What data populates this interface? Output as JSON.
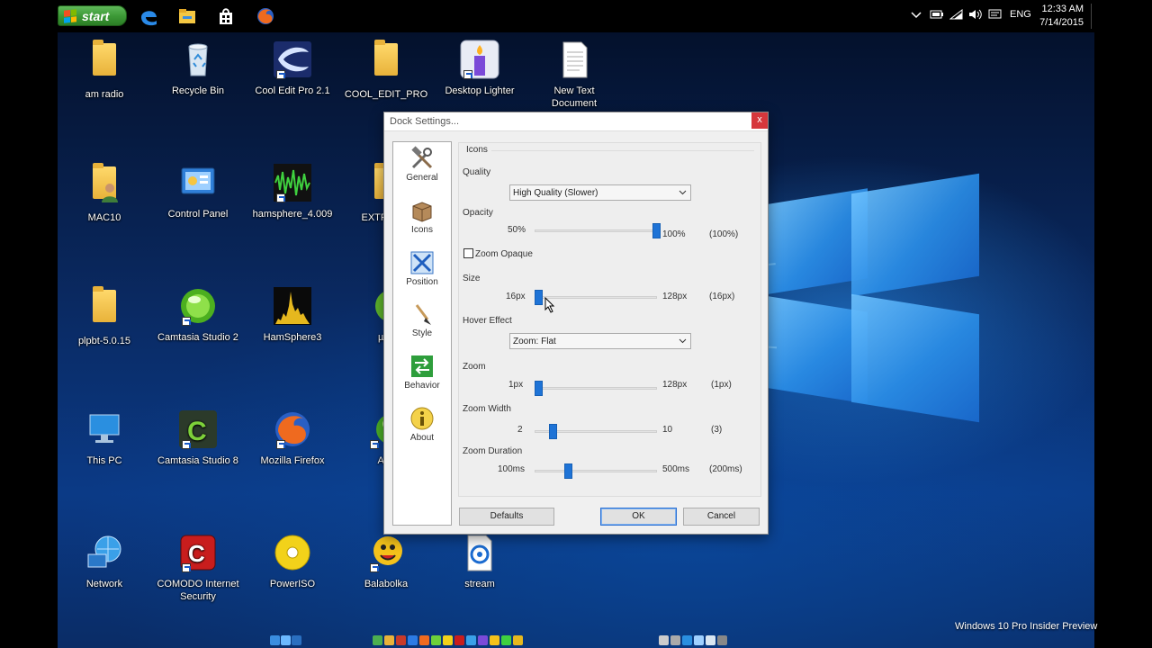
{
  "taskbar": {
    "start_label": "start",
    "tray_language": "ENG",
    "clock_time": "12:33 AM",
    "clock_date": "7/14/2015",
    "pins": [
      "edge-icon",
      "file-explorer-icon",
      "store-icon",
      "firefox-icon"
    ]
  },
  "desktop": {
    "icons": [
      {
        "label": "am radio",
        "icon": "folder-icon"
      },
      {
        "label": "Recycle Bin",
        "icon": "recycle-bin-icon"
      },
      {
        "label": "Cool Edit Pro 2.1",
        "icon": "cool-edit-icon"
      },
      {
        "label": "COOL_EDIT_PRO",
        "icon": "folder-icon"
      },
      {
        "label": "Desktop Lighter",
        "icon": "candle-icon"
      },
      {
        "label": "New Text Document",
        "icon": "text-document-icon"
      },
      {
        "label": "MAC10",
        "icon": "user-folder-icon"
      },
      {
        "label": "Control Panel",
        "icon": "control-panel-icon"
      },
      {
        "label": "hamsphere_4.009",
        "icon": "waveform-icon"
      },
      {
        "label": "EXTRA DR",
        "icon": "folder-icon"
      },
      {
        "label": "plpbt-5.0.15",
        "icon": "folder-icon"
      },
      {
        "label": "Camtasia Studio 2",
        "icon": "camtasia-orb-icon"
      },
      {
        "label": "HamSphere3",
        "icon": "spectrum-icon"
      },
      {
        "label": "µTo",
        "icon": "utorrent-icon"
      },
      {
        "label": "This PC",
        "icon": "this-pc-icon"
      },
      {
        "label": "Camtasia Studio 8",
        "icon": "camtasia-icon"
      },
      {
        "label": "Mozilla Firefox",
        "icon": "firefox-icon"
      },
      {
        "label": "Any",
        "icon": "green-orb-icon"
      },
      {
        "label": "Network",
        "icon": "network-icon"
      },
      {
        "label": "COMODO Internet Security",
        "icon": "comodo-icon"
      },
      {
        "label": "PowerISO",
        "icon": "disc-icon"
      },
      {
        "label": "Balabolka",
        "icon": "balabolka-icon"
      },
      {
        "label": "stream",
        "icon": "stream-icon"
      }
    ],
    "watermark": "Windows 10 Pro Insider Preview"
  },
  "dialog": {
    "title": "Dock Settings...",
    "close_label": "x",
    "nav": [
      {
        "label": "General",
        "icon": "tools-icon"
      },
      {
        "label": "Icons",
        "icon": "box-icon"
      },
      {
        "label": "Position",
        "icon": "position-icon"
      },
      {
        "label": "Style",
        "icon": "brush-icon"
      },
      {
        "label": "Behavior",
        "icon": "behavior-icon"
      },
      {
        "label": "About",
        "icon": "info-icon"
      }
    ],
    "group_title": "Icons",
    "quality": {
      "label": "Quality",
      "value": "High Quality (Slower)"
    },
    "opacity": {
      "label": "Opacity",
      "min": "50%",
      "max": "100%",
      "current": "(100%)",
      "fraction": 1.0
    },
    "zoom_opaque": {
      "label": "Zoom Opaque",
      "checked": false
    },
    "size": {
      "label": "Size",
      "min": "16px",
      "max": "128px",
      "current": "(16px)",
      "fraction": 0.0
    },
    "hover_effect": {
      "label": "Hover Effect",
      "value": "Zoom: Flat"
    },
    "zoom": {
      "label": "Zoom",
      "min": "1px",
      "max": "128px",
      "current": "(1px)",
      "fraction": 0.0
    },
    "zoom_width": {
      "label": "Zoom Width",
      "min": "2",
      "max": "10",
      "current": "(3)",
      "fraction": 0.125
    },
    "zoom_duration": {
      "label": "Zoom Duration",
      "min": "100ms",
      "max": "500ms",
      "current": "(200ms)",
      "fraction": 0.25
    },
    "buttons": {
      "defaults": "Defaults",
      "ok": "OK",
      "cancel": "Cancel"
    }
  },
  "colors": {
    "accent": "#1e73d6",
    "close_red": "#d6373c",
    "start_green": "#3d9a37"
  }
}
